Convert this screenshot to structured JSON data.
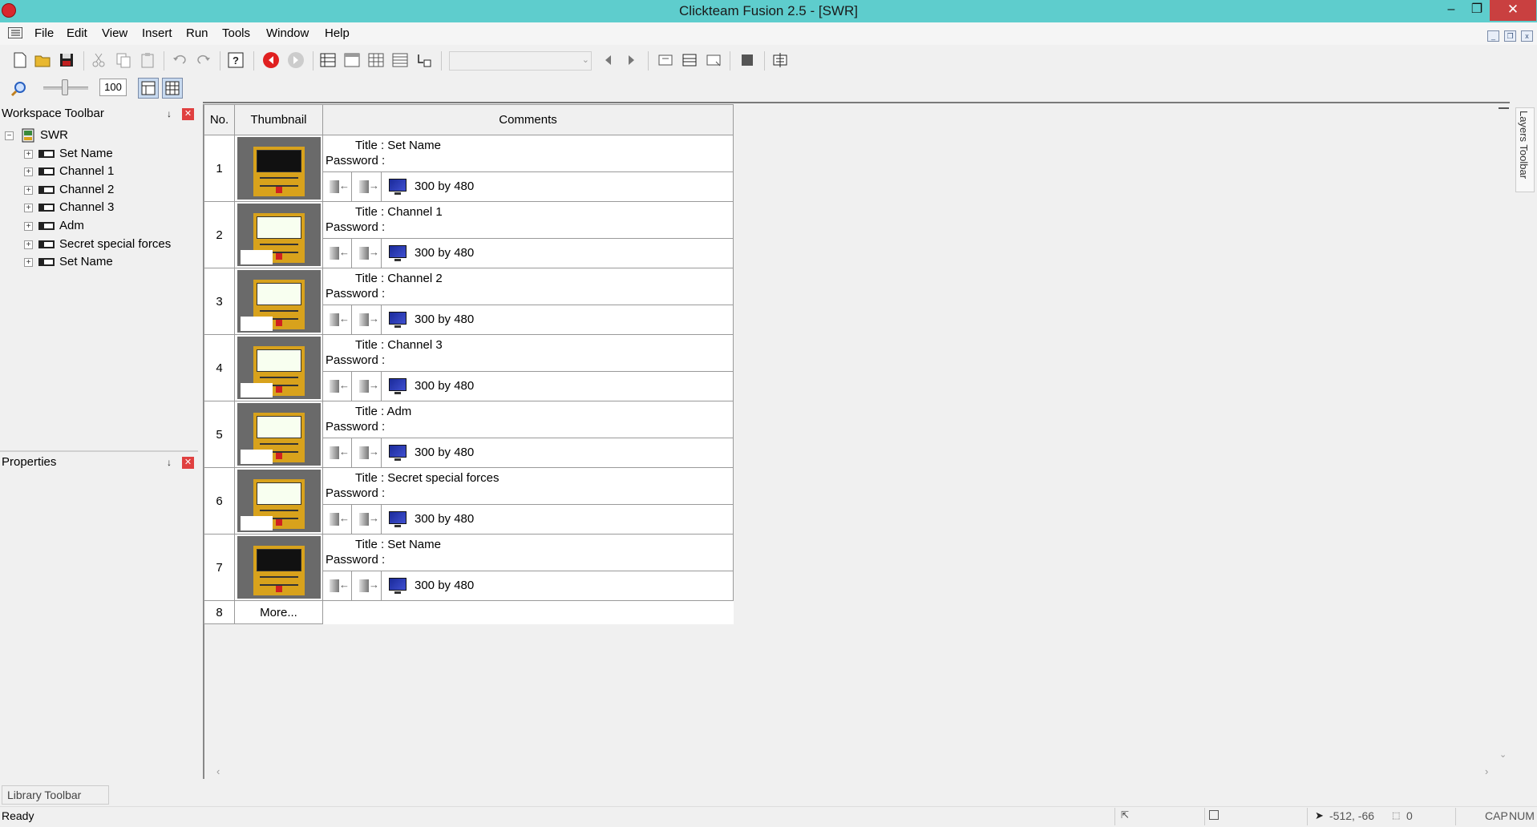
{
  "window": {
    "title": "Clickteam Fusion 2.5 - [SWR]",
    "minimize_icon": "minimize-icon",
    "maximize_icon": "restore-icon",
    "close_icon": "close-icon",
    "minimize": "–",
    "restore": "❐",
    "close": "✕"
  },
  "menu": {
    "items": [
      "File",
      "Edit",
      "View",
      "Insert",
      "Run",
      "Tools",
      "Window",
      "Help"
    ],
    "mdi_min": "_",
    "mdi_restore": "❐",
    "mdi_close": "x"
  },
  "toolbar": {
    "zoom_value": "100",
    "zoom_level_percent": 100
  },
  "workspace": {
    "header": "Workspace Toolbar",
    "root": "SWR",
    "frames": [
      "Set Name",
      "Channel 1",
      "Channel 2",
      "Channel 3",
      "Adm",
      "Secret special forces",
      "Set Name"
    ]
  },
  "properties": {
    "header": "Properties"
  },
  "storyboard": {
    "headers": {
      "no": "No.",
      "thumbnail": "Thumbnail",
      "comments": "Comments"
    },
    "rows": [
      {
        "no": "1",
        "title": "Title : Set Name",
        "password": "Password :",
        "size": "300  by  480"
      },
      {
        "no": "2",
        "title": "Title : Channel 1",
        "password": "Password :",
        "size": "300  by  480"
      },
      {
        "no": "3",
        "title": "Title : Channel 2",
        "password": "Password :",
        "size": "300  by  480"
      },
      {
        "no": "4",
        "title": "Title : Channel 3",
        "password": "Password :",
        "size": "300  by  480"
      },
      {
        "no": "5",
        "title": "Title : Adm",
        "password": "Password :",
        "size": "300  by  480"
      },
      {
        "no": "6",
        "title": "Title : Secret special forces",
        "password": "Password :",
        "size": "300  by  480"
      },
      {
        "no": "7",
        "title": "Title : Set Name",
        "password": "Password :",
        "size": "300  by  480"
      }
    ],
    "more": {
      "no": "8",
      "label": "More..."
    }
  },
  "layers_toolbar": {
    "label": "Layers Toolbar"
  },
  "library_toolbar": {
    "label": "Library Toolbar"
  },
  "status": {
    "ready": "Ready",
    "coords": "-512, -66",
    "layer": "0",
    "caps": "CAP",
    "num": "NUM"
  },
  "colors": {
    "titlebar": "#5ecdcd",
    "close_button": "#c94040",
    "panel_close": "#e04040",
    "thumbnail_body": "#d8a21c"
  }
}
